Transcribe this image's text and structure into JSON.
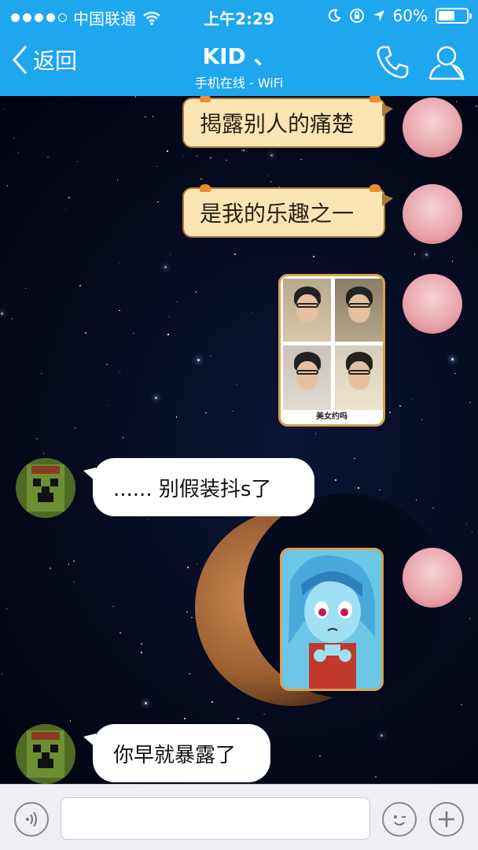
{
  "status_bar": {
    "carrier": "中国联通",
    "time": "上午2:29",
    "battery_percent": "60%",
    "battery_level": 0.6
  },
  "nav": {
    "back_label": "返回",
    "title": "KID 、",
    "subtitle": "手机在线 - WiFi"
  },
  "messages": [
    {
      "sender": "me",
      "type": "text",
      "text": "揭露别人的痛楚"
    },
    {
      "sender": "me",
      "type": "text",
      "text": "是我的乐趣之一"
    },
    {
      "sender": "me",
      "type": "image",
      "caption": "美女约吗"
    },
    {
      "sender": "friend",
      "type": "text",
      "text": "...... 别假装抖s了"
    },
    {
      "sender": "me",
      "type": "image",
      "caption": ""
    },
    {
      "sender": "friend",
      "type": "text",
      "text": "你早就暴露了"
    }
  ],
  "input": {
    "placeholder": "",
    "value": ""
  },
  "icons": [
    "back-chevron-icon",
    "phone-icon",
    "profile-icon",
    "voice-icon",
    "emoji-icon",
    "plus-icon",
    "wifi-icon",
    "moon-icon",
    "lock-rotation-icon",
    "location-arrow-icon"
  ],
  "colors": {
    "header": "#1ea6ee",
    "bubble_me": "#fbe6b3",
    "bubble_friend": "#ffffff"
  }
}
